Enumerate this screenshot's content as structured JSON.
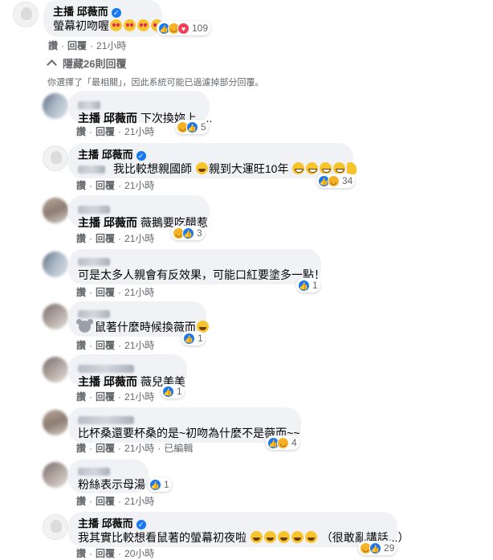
{
  "top_comment": {
    "role": "主播",
    "name": "邱薇而",
    "text": "螢幕初吻喔",
    "reaction_count": "109",
    "actions": [
      "讚",
      "回覆"
    ],
    "time": "21小時"
  },
  "hidden_replies_label": "隱藏26則回覆",
  "filter_notice": "你選擇了「最相關」，因此系統可能已過濾掉部分回覆。",
  "replies": [
    {
      "tag": "主播 邱薇而",
      "text": "下次換妳上.....",
      "reaction_count": "5",
      "time": "21小時"
    },
    {
      "role": "主播",
      "name": "邱薇而",
      "text": "我比較想親國師",
      "text2": "親到大運旺10年",
      "reaction_count": "34",
      "time": "21小時"
    },
    {
      "tag": "主播 邱薇而",
      "text": "薇鵝要吃醋惹",
      "reaction_count": "3",
      "time": "21小時"
    },
    {
      "text": "可是太多人親會有反效果，可能口紅要塗多一點！",
      "reaction_count": "1",
      "time": "21小時"
    },
    {
      "text": "鼠著什麼時候換薇而",
      "reaction_count": "1",
      "time": "21小時"
    },
    {
      "tag": "主播 邱薇而",
      "text": "薇兒美美",
      "reaction_count": "1",
      "time": "21小時"
    },
    {
      "text": "比杯桑還要杯桑的是~初吻為什麼不是薇而~~",
      "reaction_count": "4",
      "time": "21小時",
      "edited": "已編輯"
    },
    {
      "text": "粉絲表示母湯",
      "reaction_count": "1",
      "time": "21小時"
    },
    {
      "role": "主播",
      "name": "邱薇而",
      "text": "我其實比較想看鼠著的螢幕初夜啦",
      "text2": "（很敢亂講話...）",
      "reaction_count": "29",
      "time": "20小時"
    }
  ],
  "action_labels": {
    "like": "讚",
    "reply": "回覆"
  },
  "colors": {
    "bubble": "#f0f2f5",
    "meta": "#65676b",
    "like": "#1877f2",
    "haha": "#f7b125",
    "love": "#f33e58"
  }
}
